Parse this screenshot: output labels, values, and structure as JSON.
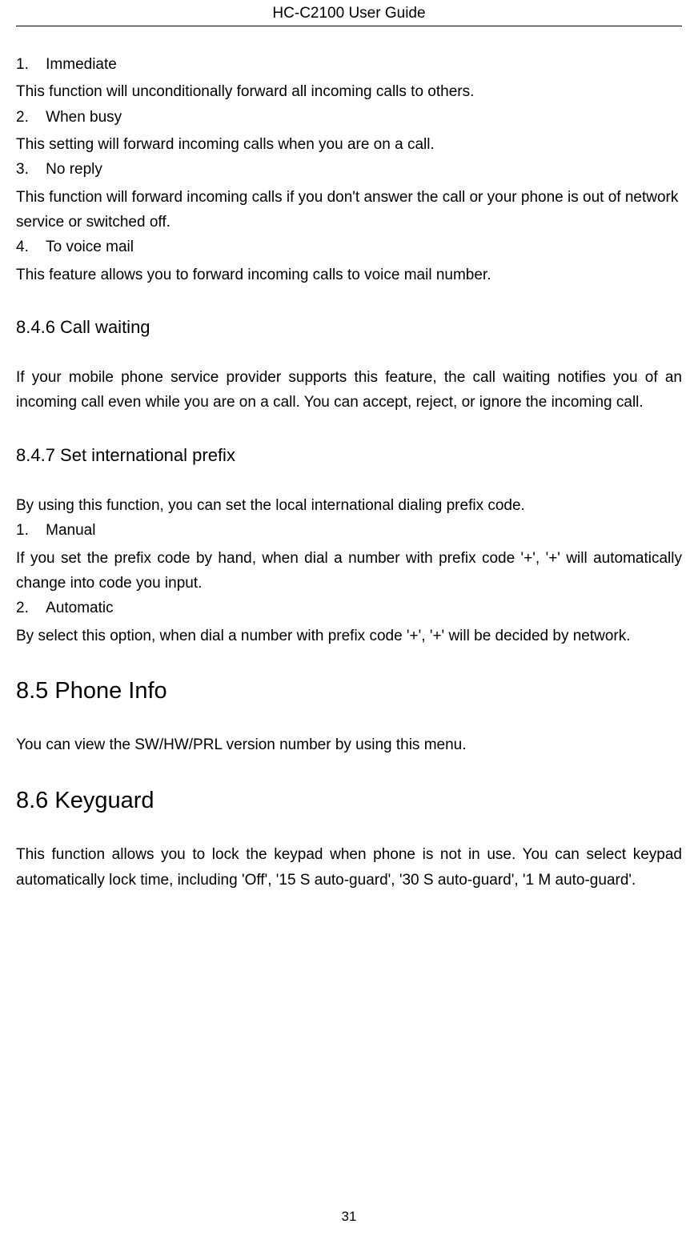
{
  "header": {
    "title": "HC-C2100 User Guide"
  },
  "section_forward": {
    "items": [
      {
        "num": "1.",
        "title": "Immediate",
        "desc": "This function will unconditionally forward all incoming calls to others."
      },
      {
        "num": "2.",
        "title": "When busy",
        "desc": "This setting will forward incoming calls when you are on a call."
      },
      {
        "num": "3.",
        "title": "No reply",
        "desc": "This function will forward incoming calls if you don't answer the call or your phone is out of network service or switched off."
      },
      {
        "num": "4.",
        "title": "To voice mail",
        "desc": "This feature allows you to forward incoming calls to voice mail number."
      }
    ]
  },
  "section_call_waiting": {
    "heading": "8.4.6 Call waiting",
    "body": "If your mobile phone service provider supports this feature, the call waiting notifies you of an incoming call even while you are on a call. You can accept, reject, or ignore the incoming call."
  },
  "section_intl_prefix": {
    "heading": "8.4.7 Set international prefix",
    "intro": "By using this function, you can set the local international dialing prefix code.",
    "items": [
      {
        "num": "1.",
        "title": "Manual",
        "desc": "If you set the prefix code by hand, when dial a number with prefix code '+', '+' will automatically change into code you input."
      },
      {
        "num": "2.",
        "title": "Automatic",
        "desc": "By select this option, when dial a number with prefix code '+', '+' will be decided by network."
      }
    ]
  },
  "section_phone_info": {
    "heading": "8.5 Phone Info",
    "body": "You can view the SW/HW/PRL version number by using this menu."
  },
  "section_keyguard": {
    "heading": "8.6 Keyguard",
    "body": "This function allows you to lock the keypad when phone is not in use. You can select keypad automatically lock time, including 'Off', '15 S auto-guard', '30 S auto-guard', '1 M auto-guard'."
  },
  "footer": {
    "page_number": "31"
  }
}
